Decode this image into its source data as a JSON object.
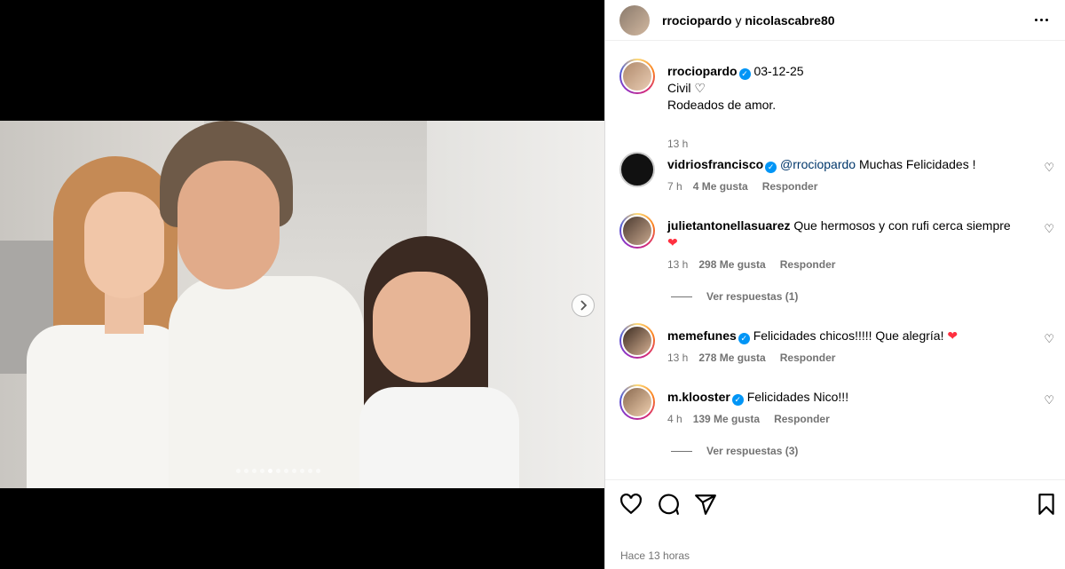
{
  "carousel": {
    "dots": 11,
    "active_dot": 4
  },
  "header": {
    "user1": "rrociopardo",
    "sep": "y",
    "user2": "nicolascabre80"
  },
  "caption": {
    "username": "rrociopardo",
    "date": "03-12-25",
    "line1": "Civil",
    "line2": "Rodeados de amor.",
    "time": "13 h"
  },
  "comments": [
    {
      "username": "vidriosfrancisco",
      "verified": true,
      "mention": "@rrociopardo",
      "text": " Muchas Felicidades !",
      "time": "7 h",
      "likes": "4 Me gusta",
      "reply": "Responder"
    },
    {
      "username": "julietantonellasuarez",
      "verified": false,
      "mention": "",
      "text": " Que hermosos y con rufi cerca siempre",
      "time": "13 h",
      "likes": "298 Me gusta",
      "reply": "Responder",
      "replies": "Ver respuestas (1)"
    },
    {
      "username": "memefunes",
      "verified": true,
      "mention": "",
      "text": " Felicidades chicos!!!!! Que alegría!",
      "time": "13 h",
      "likes": "278 Me gusta",
      "reply": "Responder"
    },
    {
      "username": "m.klooster",
      "verified": true,
      "mention": "",
      "text": " Felicidades Nico!!!",
      "time": "4 h",
      "likes": "139 Me gusta",
      "reply": "Responder",
      "replies": "Ver respuestas (3)"
    }
  ],
  "footer": {
    "posted": "Hace 13 horas"
  },
  "icons": {
    "like": "heart-icon",
    "comment": "comment-icon",
    "share": "send-icon",
    "save": "bookmark-icon"
  }
}
